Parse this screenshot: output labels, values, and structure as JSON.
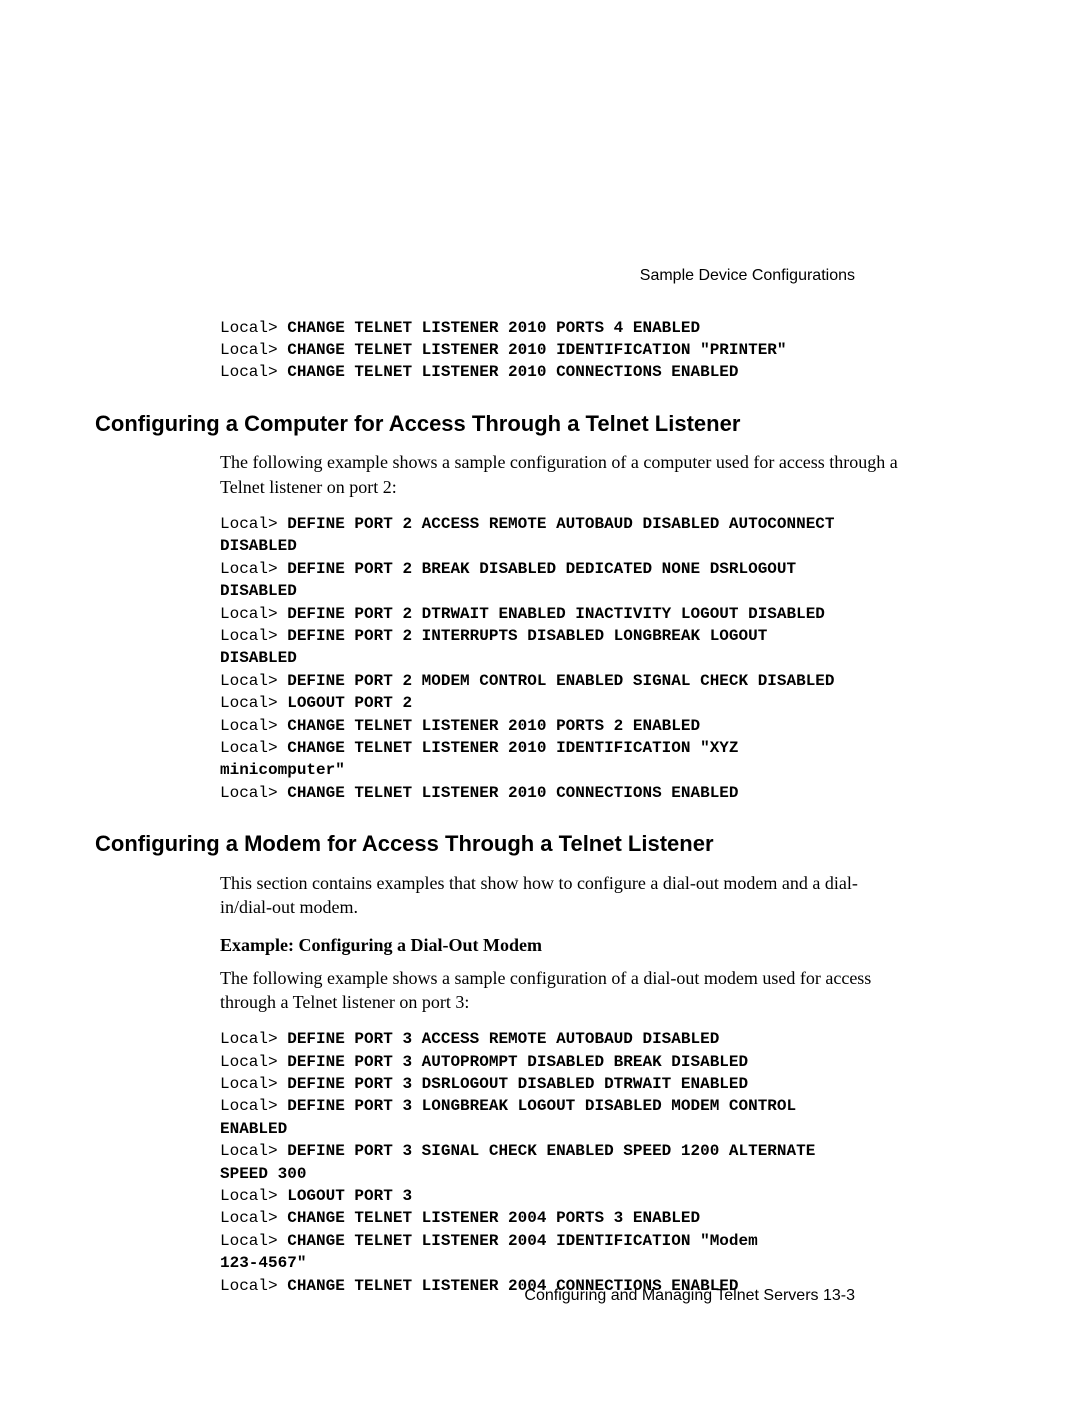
{
  "running_head": "Sample Device Configurations",
  "top_code": {
    "prompts": [
      "Local> ",
      "Local> ",
      "Local> "
    ],
    "cmds": [
      "CHANGE TELNET LISTENER 2010 PORTS 4 ENABLED",
      "CHANGE TELNET LISTENER 2010 IDENTIFICATION \"PRINTER\"",
      "CHANGE TELNET LISTENER 2010 CONNECTIONS ENABLED"
    ]
  },
  "section1": {
    "heading": "Configuring a Computer for Access Through a Telnet Listener",
    "intro": "The following example shows a sample configuration of a computer used for access through a Telnet listener on port 2:",
    "code": {
      "lines": [
        {
          "prompt": "Local> ",
          "cmd": "DEFINE PORT 2 ACCESS REMOTE AUTOBAUD DISABLED AUTOCONNECT"
        },
        {
          "prompt": "",
          "cmd": "DISABLED"
        },
        {
          "prompt": "Local> ",
          "cmd": "DEFINE PORT 2 BREAK DISABLED DEDICATED NONE DSRLOGOUT"
        },
        {
          "prompt": "",
          "cmd": "DISABLED"
        },
        {
          "prompt": "Local> ",
          "cmd": "DEFINE PORT 2 DTRWAIT ENABLED INACTIVITY LOGOUT DISABLED"
        },
        {
          "prompt": "Local> ",
          "cmd": "DEFINE PORT 2 INTERRUPTS DISABLED LONGBREAK LOGOUT"
        },
        {
          "prompt": "",
          "cmd": "DISABLED"
        },
        {
          "prompt": "Local> ",
          "cmd": "DEFINE PORT 2 MODEM CONTROL ENABLED SIGNAL CHECK DISABLED"
        },
        {
          "prompt": "Local> ",
          "cmd": "LOGOUT PORT 2"
        },
        {
          "prompt": "Local> ",
          "cmd": "CHANGE TELNET LISTENER 2010 PORTS 2 ENABLED"
        },
        {
          "prompt": "Local> ",
          "cmd": "CHANGE TELNET LISTENER 2010 IDENTIFICATION \"XYZ"
        },
        {
          "prompt": "",
          "cmd": "minicomputer\""
        },
        {
          "prompt": "Local> ",
          "cmd": "CHANGE TELNET LISTENER 2010 CONNECTIONS ENABLED"
        }
      ]
    }
  },
  "section2": {
    "heading": "Configuring a Modem for Access Through a Telnet Listener",
    "intro": "This section contains examples that show how to configure a dial-out modem and a dial-in/dial-out modem.",
    "subhead": "Example: Configuring a Dial-Out Modem",
    "subintro": "The following example shows a sample configuration of a dial-out modem used for access through a Telnet listener on port 3:",
    "code": {
      "lines": [
        {
          "prompt": "Local> ",
          "cmd": "DEFINE PORT 3 ACCESS REMOTE AUTOBAUD DISABLED"
        },
        {
          "prompt": "Local> ",
          "cmd": "DEFINE PORT 3 AUTOPROMPT DISABLED BREAK DISABLED"
        },
        {
          "prompt": "Local> ",
          "cmd": "DEFINE PORT 3 DSRLOGOUT DISABLED DTRWAIT ENABLED"
        },
        {
          "prompt": "Local> ",
          "cmd": "DEFINE PORT 3 LONGBREAK LOGOUT DISABLED MODEM CONTROL"
        },
        {
          "prompt": "",
          "cmd": "ENABLED"
        },
        {
          "prompt": "Local> ",
          "cmd": "DEFINE PORT 3 SIGNAL CHECK ENABLED SPEED 1200 ALTERNATE"
        },
        {
          "prompt": "",
          "cmd": "SPEED 300"
        },
        {
          "prompt": "Local> ",
          "cmd": "LOGOUT PORT 3"
        },
        {
          "prompt": "Local> ",
          "cmd": "CHANGE TELNET LISTENER 2004 PORTS 3 ENABLED"
        },
        {
          "prompt": "Local> ",
          "cmd": "CHANGE TELNET LISTENER 2004 IDENTIFICATION \"Modem"
        },
        {
          "prompt": "",
          "cmd": "123-4567\""
        },
        {
          "prompt": "Local> ",
          "cmd": "CHANGE TELNET LISTENER 2004 CONNECTIONS ENABLED"
        }
      ]
    }
  },
  "footer": "Configuring and Managing Telnet Servers 13-3"
}
